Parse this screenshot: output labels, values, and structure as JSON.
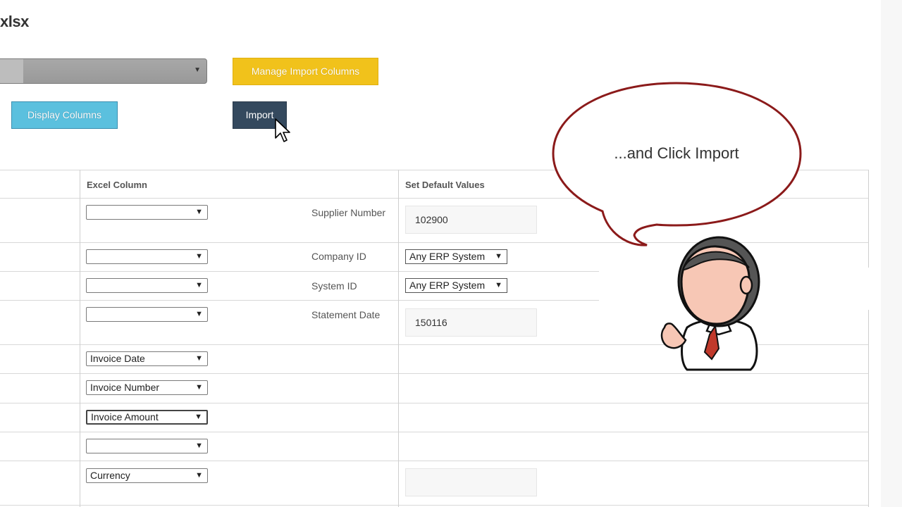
{
  "page": {
    "title": "xlsx"
  },
  "toolbar": {
    "manage_label": "Manage Import Columns",
    "display_label": "Display Columns",
    "import_label": "Import"
  },
  "table": {
    "headers": {
      "excel": "Excel Column",
      "defaults": "Set Default Values"
    },
    "rows": [
      {
        "excel": "",
        "label": "Supplier Number",
        "default": "102900"
      },
      {
        "excel": "",
        "label": "Company ID",
        "default": "Any ERP System"
      },
      {
        "excel": "",
        "label": "System ID",
        "default": "Any ERP System"
      },
      {
        "excel": "",
        "label": "Statement Date",
        "default": "150116"
      },
      {
        "excel": "Invoice Date"
      },
      {
        "excel": "Invoice Number"
      },
      {
        "excel": "Invoice Amount"
      },
      {
        "excel": ""
      },
      {
        "excel": "Currency",
        "default": ""
      }
    ]
  },
  "callout": {
    "text": "...and Click Import"
  },
  "colors": {
    "manage": "#f1c21b",
    "display": "#5bc0de",
    "import": "#34495e",
    "bubble_border": "#8b1a1a",
    "tie": "#c0392b"
  }
}
